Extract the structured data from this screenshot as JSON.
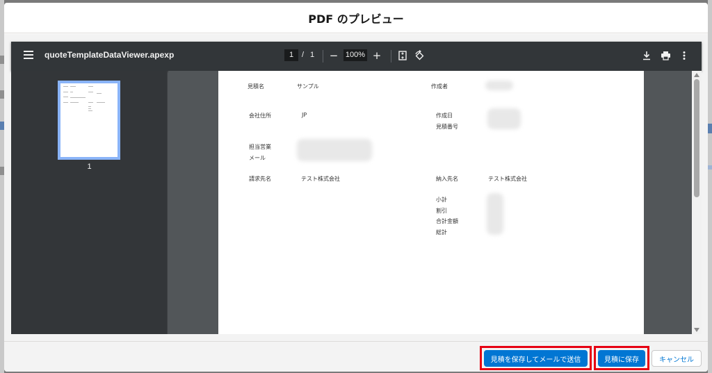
{
  "modal": {
    "title": "PDF のプレビュー"
  },
  "viewer": {
    "filename": "quoteTemplateDataViewer.apexp",
    "current_page": "1",
    "page_separator": "/",
    "total_pages": "1",
    "zoom": "100%",
    "zoom_out_glyph": "−",
    "zoom_in_glyph": "+",
    "thumbnail_label": "1",
    "icons": {
      "menu": "menu-icon",
      "fit": "fit-page-icon",
      "rotate": "rotate-icon",
      "download": "download-icon",
      "print": "print-icon",
      "more": "more-vert-icon"
    }
  },
  "document": {
    "quote_name_label": "見積名",
    "quote_name_value": "サンプル",
    "author_label": "作成者",
    "company_address_label": "会社住所",
    "company_address_value": "JP",
    "created_date_label": "作成日",
    "quote_number_label": "見積番号",
    "sales_rep_label": "担当営業",
    "email_label": "メール",
    "bill_to_label": "請求先名",
    "bill_to_value": "テスト株式会社",
    "ship_to_label": "納入先名",
    "ship_to_value": "テスト株式会社",
    "subtotal_label": "小計",
    "discount_label": "割引",
    "total_amount_label": "合計金額",
    "grand_total_label": "総計"
  },
  "footer": {
    "save_and_email_label": "見積を保存してメールで送信",
    "save_label": "見積に保存",
    "cancel_label": "キャンセル"
  },
  "colors": {
    "brand": "#0176d3",
    "highlight": "#e60012",
    "viewer_toolbar": "#323639",
    "viewer_background": "#525659"
  }
}
